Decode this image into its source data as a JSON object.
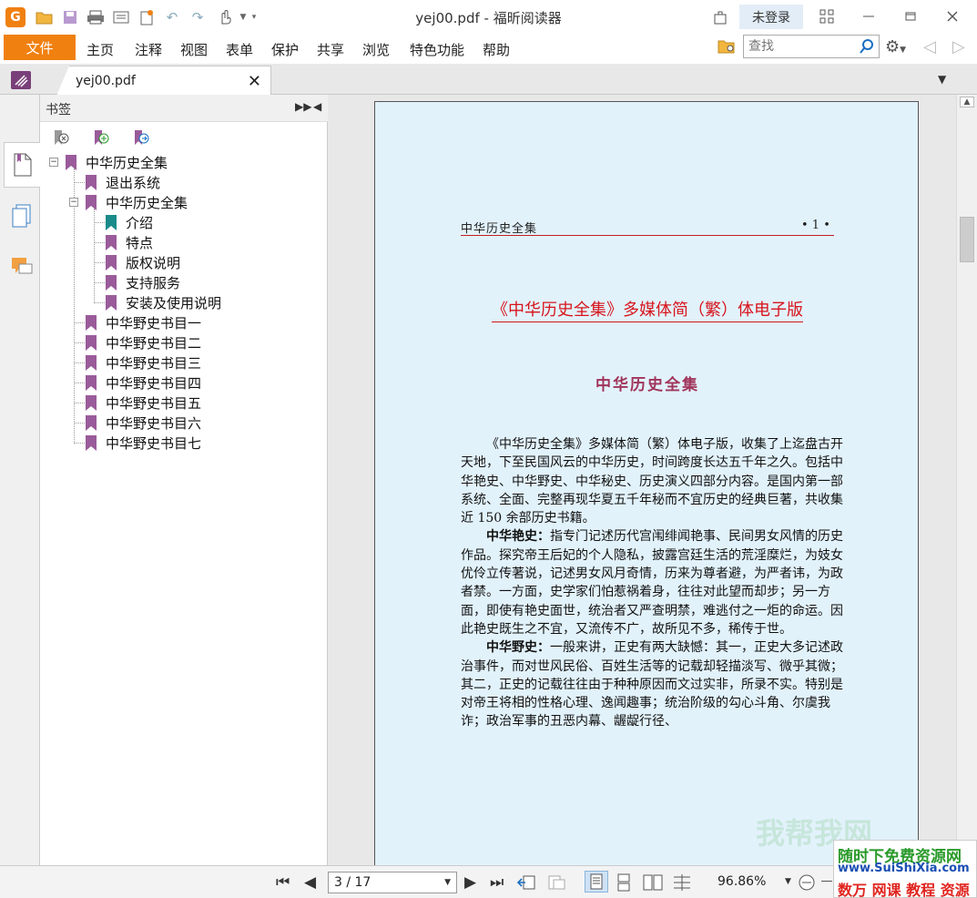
{
  "window": {
    "title": "yej00.pdf - 福昕阅读器",
    "login_label": "未登录"
  },
  "menu": {
    "file_label": "文件",
    "items": [
      "主页",
      "注释",
      "视图",
      "表单",
      "保护",
      "共享",
      "浏览",
      "特色功能",
      "帮助"
    ],
    "search_placeholder": "查找"
  },
  "tab": {
    "label": "yej00.pdf"
  },
  "bookmarks": {
    "panel_title": "书签",
    "root": "中华历史全集",
    "exit": "退出系统",
    "group": "中华历史全集",
    "children": [
      "介绍",
      "特点",
      "版权说明",
      "支持服务",
      "安装及使用说明"
    ],
    "catalogs": [
      "中华野史书目一",
      "中华野史书目二",
      "中华野史书目三",
      "中华野史书目四",
      "中华野史书目五",
      "中华野史书目六",
      "中华野史书目七"
    ]
  },
  "document": {
    "running_head": "中华历史全集",
    "running_page": "• 1 •",
    "heading": "《中华历史全集》多媒体简（繁）体电子版",
    "subheading": "中华历史全集",
    "para1": "《中华历史全集》多媒体简（繁）体电子版，收集了上迄盘古开天地，下至民国风云的中华历史，时间跨度长达五千年之久。包括中华艳史、中华野史、中华秘史、历史演义四部分内容。是国内第一部系统、全面、完整再现华夏五千年秘而不宜历史的经典巨著，共收集近 150 余部历史书籍。",
    "para2_lead": "中华艳史：",
    "para2": "指专门记述历代宫闱绯闻艳事、民间男女风情的历史作品。探究帝王后妃的个人隐私，披露宫廷生活的荒淫糜烂，为妓女优伶立传著说，记述男女风月奇情，历来为尊者避，为严者讳，为政者禁。一方面，史学家们怕惹祸着身，往往对此望而却步；另一方面，即使有艳史面世，统治者又严查明禁，难逃付之一炬的命运。因此艳史既生之不宜，又流传不广，故所见不多，稀传于世。",
    "para3_lead": "中华野史：",
    "para3": "一般来讲，正史有两大缺憾：其一，正史大多记述政治事件，而对世风民俗、百姓生活等的记载却轻描淡写、微乎其微；其二，正史的记载往往由于种种原因而文过实非，所录不实。特别是对帝王将相的性格心理、逸闻趣事；统治阶级的勾心斗角、尔虞我诈；政治军事的丑恶内幕、龌龊行径、"
  },
  "status": {
    "page_indicator": "3 / 17",
    "zoom": "96.86%"
  },
  "watermark": {
    "line1": "随时下免费资源网",
    "line2": "www.SuiShiXia.com",
    "line3": "数万 网课 教程 资源",
    "faint": "我帮我网"
  },
  "colors": {
    "accent_orange": "#f08010",
    "bookmark_purple": "#9a5b9a",
    "bookmark_teal": "#1a8a8a",
    "page_bg": "#e2f2fb",
    "heading_red": "#d8141c"
  }
}
